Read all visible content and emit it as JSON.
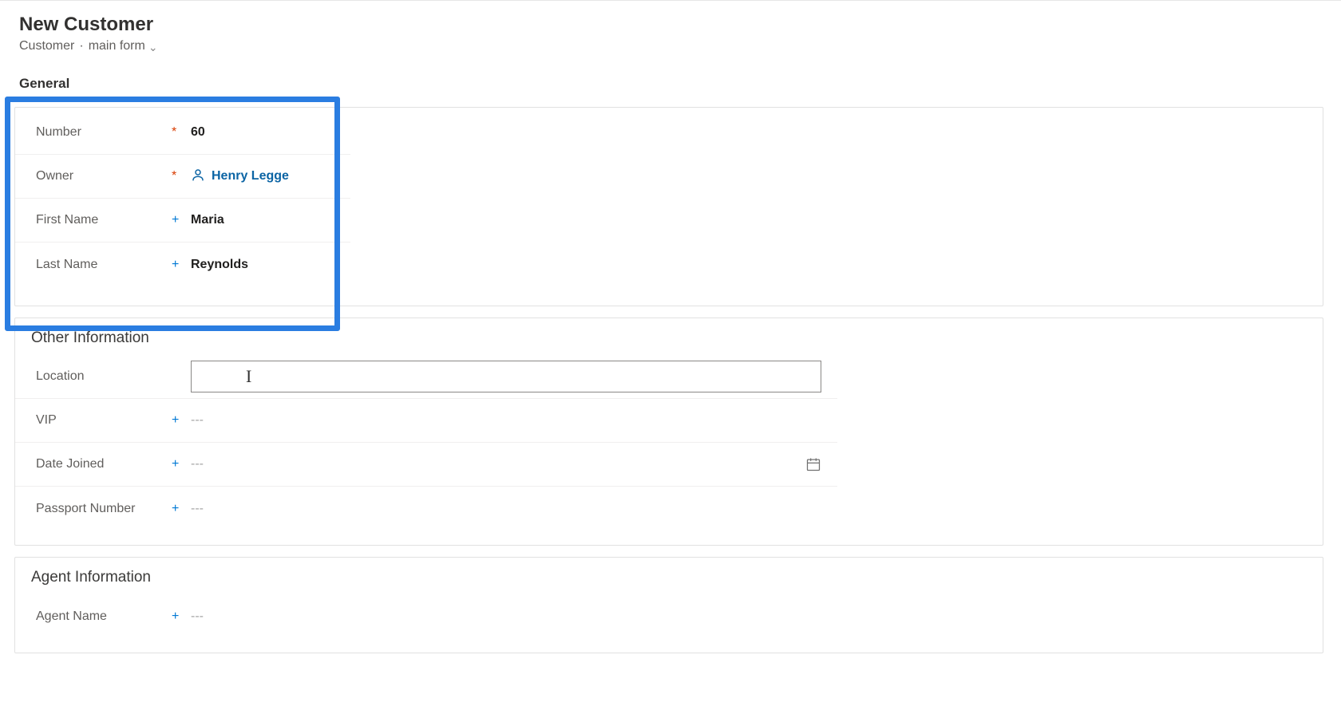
{
  "header": {
    "title": "New Customer",
    "entity_label": "Customer",
    "form_name": "main form"
  },
  "tabs": {
    "general_label": "General"
  },
  "general_section": {
    "fields": {
      "number": {
        "label": "Number",
        "value": "60",
        "marker": "required"
      },
      "owner": {
        "label": "Owner",
        "value": "Henry Legge",
        "marker": "required",
        "type": "lookup"
      },
      "first_name": {
        "label": "First Name",
        "value": "Maria",
        "marker": "recommended"
      },
      "last_name": {
        "label": "Last Name",
        "value": "Reynolds",
        "marker": "recommended"
      }
    }
  },
  "other_section": {
    "title": "Other Information",
    "fields": {
      "location": {
        "label": "Location",
        "value": "",
        "marker": "none",
        "type": "text"
      },
      "vip": {
        "label": "VIP",
        "value": "---",
        "marker": "recommended"
      },
      "date_joined": {
        "label": "Date Joined",
        "value": "---",
        "marker": "recommended",
        "type": "date"
      },
      "passport_number": {
        "label": "Passport Number",
        "value": "---",
        "marker": "recommended"
      }
    }
  },
  "agent_section": {
    "title": "Agent Information",
    "fields": {
      "agent_name": {
        "label": "Agent Name",
        "value": "---",
        "marker": "recommended"
      }
    }
  },
  "placeholders": {
    "empty": "---"
  }
}
